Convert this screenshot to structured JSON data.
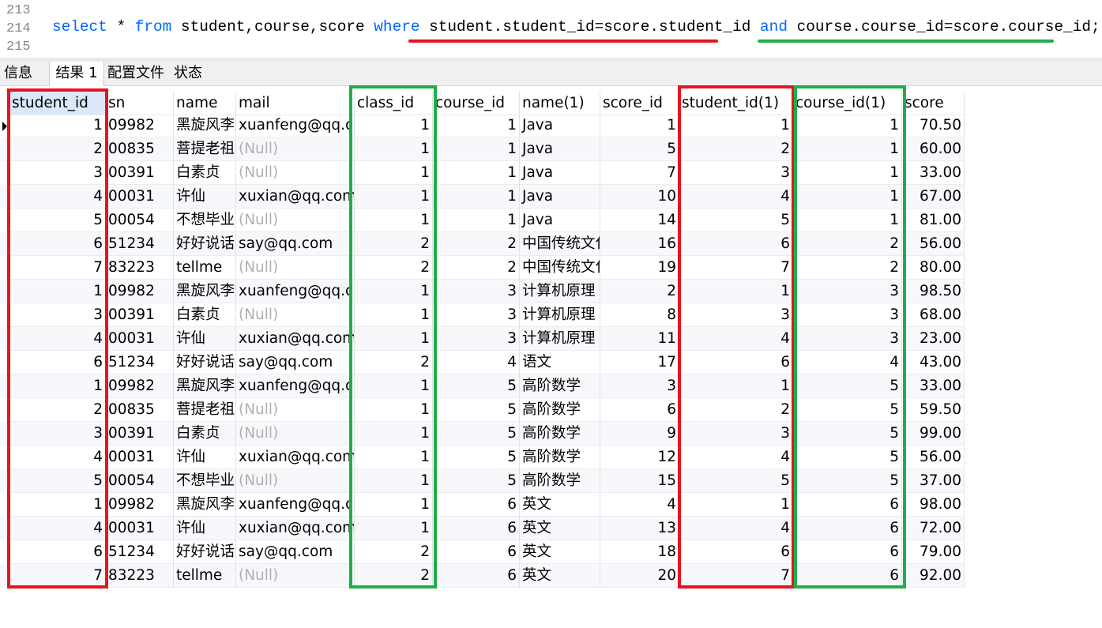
{
  "editor": {
    "line_numbers": [
      "213",
      "214",
      "215"
    ],
    "sql": {
      "k1": "select",
      "t1": " * ",
      "k2": "from",
      "t2": " student,course,score ",
      "k3": "where",
      "t3": " ",
      "c1": "student.student_id=score.student_id",
      "t4": " ",
      "k4": "and",
      "t5": " ",
      "c2": "course.course_id=score.course_id;"
    }
  },
  "tabs": [
    "信息",
    "结果 1",
    "配置文件",
    "状态"
  ],
  "active_tab": "结果 1",
  "grid": {
    "columns": [
      "student_id",
      "sn",
      "name",
      "mail",
      "class_id",
      "course_id",
      "name(1)",
      "score_id",
      "student_id(1)",
      "course_id(1)",
      "score"
    ],
    "rows": [
      [
        "1",
        "09982",
        "黑旋风李逵",
        "xuanfeng@qq.com",
        "1",
        "1",
        "Java",
        "1",
        "1",
        "1",
        "70.50"
      ],
      [
        "2",
        "00835",
        "菩提老祖",
        "(Null)",
        "1",
        "1",
        "Java",
        "5",
        "2",
        "1",
        "60.00"
      ],
      [
        "3",
        "00391",
        "白素贞",
        "(Null)",
        "1",
        "1",
        "Java",
        "7",
        "3",
        "1",
        "33.00"
      ],
      [
        "4",
        "00031",
        "许仙",
        "xuxian@qq.com",
        "1",
        "1",
        "Java",
        "10",
        "4",
        "1",
        "67.00"
      ],
      [
        "5",
        "00054",
        "不想毕业",
        "(Null)",
        "1",
        "1",
        "Java",
        "14",
        "5",
        "1",
        "81.00"
      ],
      [
        "6",
        "51234",
        "好好说话",
        "say@qq.com",
        "2",
        "2",
        "中国传统文化",
        "16",
        "6",
        "2",
        "56.00"
      ],
      [
        "7",
        "83223",
        "tellme",
        "(Null)",
        "2",
        "2",
        "中国传统文化",
        "19",
        "7",
        "2",
        "80.00"
      ],
      [
        "1",
        "09982",
        "黑旋风李逵",
        "xuanfeng@qq.com",
        "1",
        "3",
        "计算机原理",
        "2",
        "1",
        "3",
        "98.50"
      ],
      [
        "3",
        "00391",
        "白素贞",
        "(Null)",
        "1",
        "3",
        "计算机原理",
        "8",
        "3",
        "3",
        "68.00"
      ],
      [
        "4",
        "00031",
        "许仙",
        "xuxian@qq.com",
        "1",
        "3",
        "计算机原理",
        "11",
        "4",
        "3",
        "23.00"
      ],
      [
        "6",
        "51234",
        "好好说话",
        "say@qq.com",
        "2",
        "4",
        "语文",
        "17",
        "6",
        "4",
        "43.00"
      ],
      [
        "1",
        "09982",
        "黑旋风李逵",
        "xuanfeng@qq.com",
        "1",
        "5",
        "高阶数学",
        "3",
        "1",
        "5",
        "33.00"
      ],
      [
        "2",
        "00835",
        "菩提老祖",
        "(Null)",
        "1",
        "5",
        "高阶数学",
        "6",
        "2",
        "5",
        "59.50"
      ],
      [
        "3",
        "00391",
        "白素贞",
        "(Null)",
        "1",
        "5",
        "高阶数学",
        "9",
        "3",
        "5",
        "99.00"
      ],
      [
        "4",
        "00031",
        "许仙",
        "xuxian@qq.com",
        "1",
        "5",
        "高阶数学",
        "12",
        "4",
        "5",
        "56.00"
      ],
      [
        "5",
        "00054",
        "不想毕业",
        "(Null)",
        "1",
        "5",
        "高阶数学",
        "15",
        "5",
        "5",
        "37.00"
      ],
      [
        "1",
        "09982",
        "黑旋风李逵",
        "xuanfeng@qq.com",
        "1",
        "6",
        "英文",
        "4",
        "1",
        "6",
        "98.00"
      ],
      [
        "4",
        "00031",
        "许仙",
        "xuxian@qq.com",
        "1",
        "6",
        "英文",
        "13",
        "4",
        "6",
        "72.00"
      ],
      [
        "6",
        "51234",
        "好好说话",
        "say@qq.com",
        "2",
        "6",
        "英文",
        "18",
        "6",
        "6",
        "79.00"
      ],
      [
        "7",
        "83223",
        "tellme",
        "(Null)",
        "2",
        "6",
        "英文",
        "20",
        "7",
        "6",
        "92.00"
      ]
    ]
  },
  "colors": {
    "keyword": "#0066ff",
    "red_highlight": "#e8141f",
    "green_highlight": "#1fae4a",
    "null_text": "#b0b0b0",
    "selected_header": "#dbe8fa"
  },
  "icons": {
    "current_row_marker": "triangle-right-icon"
  }
}
